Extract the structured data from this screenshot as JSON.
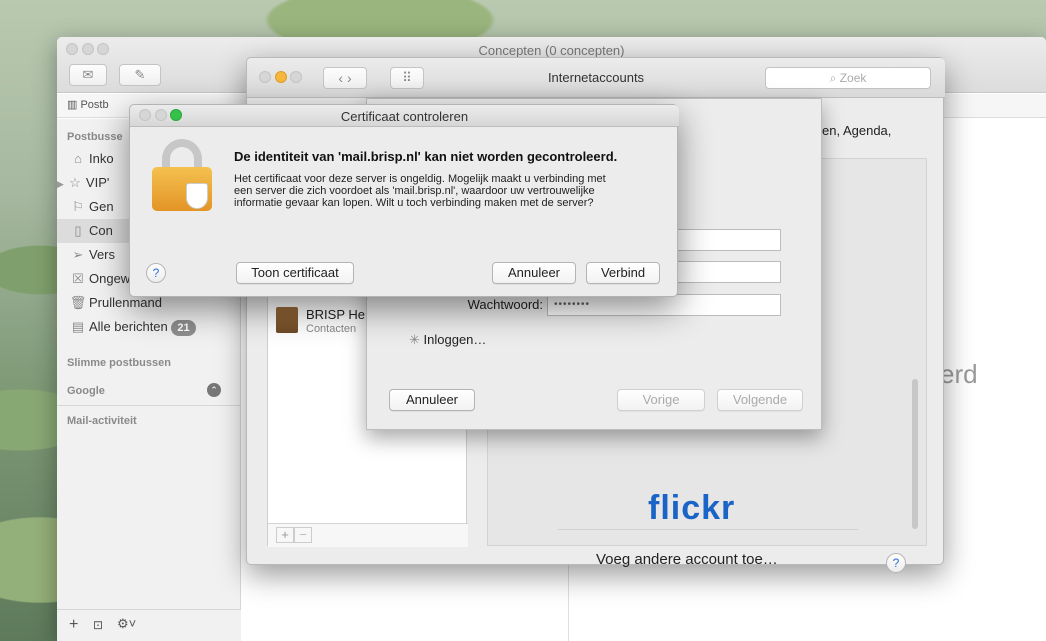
{
  "mail": {
    "title": "Concepten (0 concepten)",
    "toolbar": {
      "compose_icon": "compose-icon",
      "mailbox_icon": "envelope-icon"
    },
    "mailboxes_tab": "Postb",
    "sidebar": {
      "section_postbussen": "Postbusse",
      "items": [
        {
          "label": "Inko",
          "icon": "inbox-icon"
        },
        {
          "label": "VIP'",
          "icon": "star-icon"
        },
        {
          "label": "Gen",
          "icon": "flag-icon"
        },
        {
          "label": "Con",
          "icon": "draft-icon"
        },
        {
          "label": "Vers",
          "icon": "sent-icon"
        },
        {
          "label": "Ongewenst",
          "icon": "junk-icon"
        },
        {
          "label": "Prullenmand",
          "icon": "trash-icon"
        },
        {
          "label": "Alle berichten",
          "icon": "archive-icon",
          "badge": "21"
        }
      ],
      "section_smart": "Slimme postbussen",
      "section_google": "Google",
      "section_activity": "Mail-activiteit"
    },
    "bottom_bar": {
      "add": "+",
      "settings": "⚙"
    },
    "right_text_fragment": "erd"
  },
  "internet_accounts": {
    "title": "Internetaccounts",
    "search_placeholder": "Zoek",
    "right_text_fragment": "en, Agenda,",
    "list_item": {
      "name": "BRISP He",
      "subtitle": "Contacten"
    },
    "flickr": "flickr",
    "add_account": "Voeg andere account toe…",
    "help": "?"
  },
  "login_sheet": {
    "password_label": "Wachtwoord:",
    "password_value": "••••••••",
    "status": "Inloggen…",
    "cancel": "Annuleer",
    "previous": "Vorige",
    "next": "Volgende"
  },
  "certificate": {
    "title": "Certificaat controleren",
    "heading": "De identiteit van 'mail.brisp.nl' kan niet worden gecontroleerd.",
    "body_line1": "Het certificaat voor deze server is ongeldig. Mogelijk maakt u verbinding met",
    "body_line2": "een server die zich voordoet als 'mail.brisp.nl', waardoor uw vertrouwelijke",
    "body_line3": "informatie gevaar kan lopen. Wilt u toch verbinding maken met de server?",
    "show_certificate": "Toon certificaat",
    "cancel": "Annuleer",
    "connect": "Verbind",
    "help": "?"
  },
  "colors": {
    "flickr_blue": "#1a64c8",
    "accent": "#2a6fd8"
  }
}
